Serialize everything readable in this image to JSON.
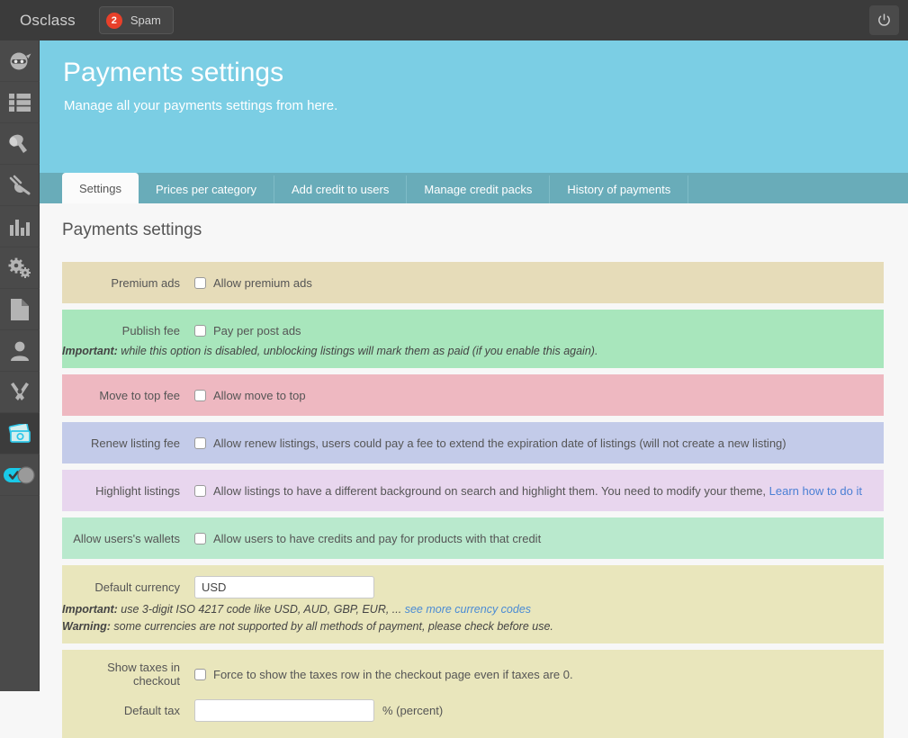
{
  "topbar": {
    "brand": "Osclass",
    "spam_badge": "2",
    "spam_label": "Spam",
    "power_icon": "power-icon"
  },
  "sidebar": {
    "items": [
      {
        "icon": "ninja-head-icon",
        "active": false
      },
      {
        "icon": "list-icon",
        "active": false
      },
      {
        "icon": "paint-roller-icon",
        "active": false
      },
      {
        "icon": "plug-icon",
        "active": false
      },
      {
        "icon": "bar-chart-icon",
        "active": false
      },
      {
        "icon": "gears-icon",
        "active": false
      },
      {
        "icon": "page-icon",
        "active": false
      },
      {
        "icon": "user-icon",
        "active": false
      },
      {
        "icon": "tools-icon",
        "active": false
      },
      {
        "icon": "money-icon",
        "active": true
      },
      {
        "icon": "toggle-switch-icon",
        "active": false
      }
    ]
  },
  "header": {
    "title": "Payments settings",
    "subtitle": "Manage all your payments settings from here.",
    "bg_color": "#7bcee4"
  },
  "tabs": [
    {
      "label": "Settings",
      "active": true
    },
    {
      "label": "Prices per category",
      "active": false
    },
    {
      "label": "Add credit to users",
      "active": false
    },
    {
      "label": "Manage credit packs",
      "active": false
    },
    {
      "label": "History of payments",
      "active": false
    }
  ],
  "main": {
    "section_title": "Payments settings",
    "rows": [
      {
        "name": "premium-ads",
        "label": "Premium ads",
        "checkbox_text": "Allow premium ads",
        "checked": false,
        "bg": "#e6dcb9"
      },
      {
        "name": "publish-fee",
        "label": "Publish fee",
        "checkbox_text": "Pay per post ads",
        "checked": false,
        "bg": "#a8e6bc",
        "note_bold": "Important:",
        "note_text": " while this option is disabled, unblocking listings will mark them as paid (if you enable this again)."
      },
      {
        "name": "move-to-top-fee",
        "label": "Move to top fee",
        "checkbox_text": "Allow move to top",
        "checked": false,
        "bg": "#eeb8c1"
      },
      {
        "name": "renew-listing-fee",
        "label": "Renew listing fee",
        "checkbox_text": "Allow renew listings, users could pay a fee to extend the expiration date of listings (will not create a new listing)",
        "checked": false,
        "bg": "#c3cbe9"
      },
      {
        "name": "highlight-listings",
        "label": "Highlight listings",
        "checkbox_text": "Allow listings to have a different background on search and highlight them. You need to modify your theme, ",
        "link_text": "Learn how to do it",
        "checked": false,
        "bg": "#e8d6ee"
      },
      {
        "name": "allow-users-wallets",
        "label": "Allow users's wallets",
        "checkbox_text": "Allow users to have credits and pay for products with that credit",
        "checked": false,
        "bg": "#b9e9cd"
      }
    ],
    "currency_row": {
      "label": "Default currency",
      "value": "USD",
      "placeholder": "",
      "bg": "#e9e6bc",
      "note1_bold": "Important:",
      "note1_text": " use 3-digit ISO 4217 code like USD, AUD, GBP, EUR, ... ",
      "note1_link": "see more currency codes",
      "note2_bold": "Warning:",
      "note2_text": " some currencies are not supported by all methods of payment, please check before use."
    },
    "taxes_row": {
      "label": "Show taxes in checkout",
      "checkbox_text": "Force to show the taxes row in the checkout page even if taxes are 0.",
      "checked": false,
      "tax_label": "Default tax",
      "tax_value": "",
      "tax_suffix": "% (percent)",
      "bg": "#e9e6bc"
    }
  },
  "colors": {
    "accent_header": "#7bcee4",
    "tabbar": "#69acb9",
    "topbar": "#3b3b3b",
    "sidebar": "#4a4a4a",
    "badge_red": "#e8402a",
    "link_blue": "#4a7fd4",
    "toggle_cyan": "#19c9e8"
  }
}
